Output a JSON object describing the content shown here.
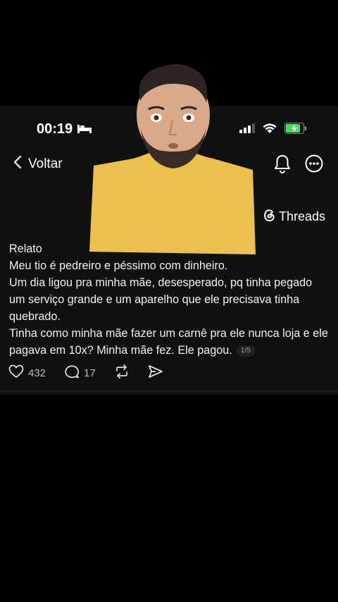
{
  "status_bar": {
    "time": "00:19",
    "bed_icon": "bed-icon",
    "signal_icon": "cellular-signal-icon",
    "wifi_icon": "wifi-icon",
    "battery_icon": "battery-charging-icon"
  },
  "nav": {
    "back_label": "Voltar",
    "back_icon": "chevron-left-icon",
    "notification_icon": "bell-icon",
    "more_icon": "more-options-icon"
  },
  "brand": {
    "name": "Threads",
    "icon": "threads-logo-icon"
  },
  "post": {
    "lines": [
      "Relato",
      "Meu tio é pedreiro e péssimo com dinheiro.",
      "Um dia ligou pra minha mãe, desesperado, pq tinha pegado um serviço grande e um aparelho que ele precisava tinha quebrado.",
      "Tinha como minha mãe fazer um carnê pra ele nunca loja e ele pagava em 10x? Minha mãe fez. Ele pagou."
    ],
    "page_indicator": "1/5"
  },
  "actions": {
    "likes": "432",
    "comments": "17",
    "like_icon": "heart-icon",
    "comment_icon": "comment-bubble-icon",
    "repost_icon": "repost-icon",
    "share_icon": "send-icon"
  },
  "colors": {
    "background": "#000000",
    "panel": "#101010",
    "shirt": "#ecc050",
    "battery_green": "#4cd964"
  }
}
